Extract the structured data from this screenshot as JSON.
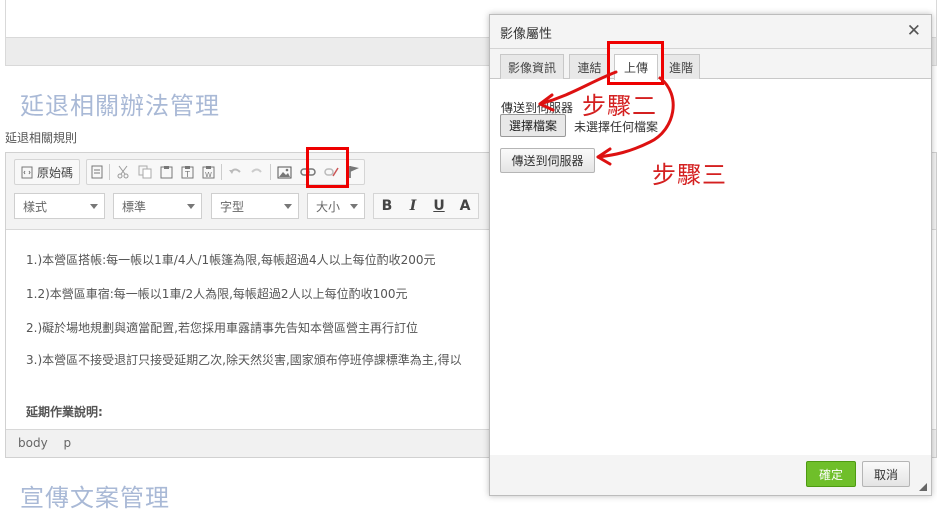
{
  "page": {
    "section1_title": "延退相關辦法管理",
    "section1_sublabel": "延退相關規則",
    "section2_title": "宣傳文案管理"
  },
  "editor": {
    "source_label": "原始碼",
    "combos": {
      "style": "樣式",
      "format": "標準",
      "font": "字型",
      "size": "大小"
    },
    "format_buttons": [
      "B",
      "I",
      "U",
      "A"
    ],
    "content_lines": [
      "1.)本營區搭帳:每一帳以1車/4人/1帳篷為限,每帳超過4人以上每位酌收200元",
      "1.2)本營區車宿:每一帳以1車/2人為限,每帳超過2人以上每位酌收100元",
      "2.)礙於場地規劃與適當配置,若您採用車露請事先告知本營區營主再行訂位",
      "3.)本營區不接受退訂只接受延期乙次,除天然災害,國家頒布停班停課標準為主,得以"
    ],
    "content_heading": "延期作業說明:",
    "status_path": [
      "body",
      "p"
    ]
  },
  "dialog": {
    "title": "影像屬性",
    "tabs": [
      "影像資訊",
      "連結",
      "上傳",
      "進階"
    ],
    "active_tab": "上傳",
    "upload_label": "傳送到伺服器",
    "choose_file_label": "選擇檔案",
    "no_file_label": "未選擇任何檔案",
    "send_button_label": "傳送到伺服器",
    "ok_label": "確定",
    "cancel_label": "取消"
  },
  "annotations": {
    "step2": "步驟二",
    "step3": "步驟三",
    "color": "#dd1111"
  },
  "colors": {
    "section_title": "#a9b9d6",
    "ok_button": "#6fbf2a"
  }
}
